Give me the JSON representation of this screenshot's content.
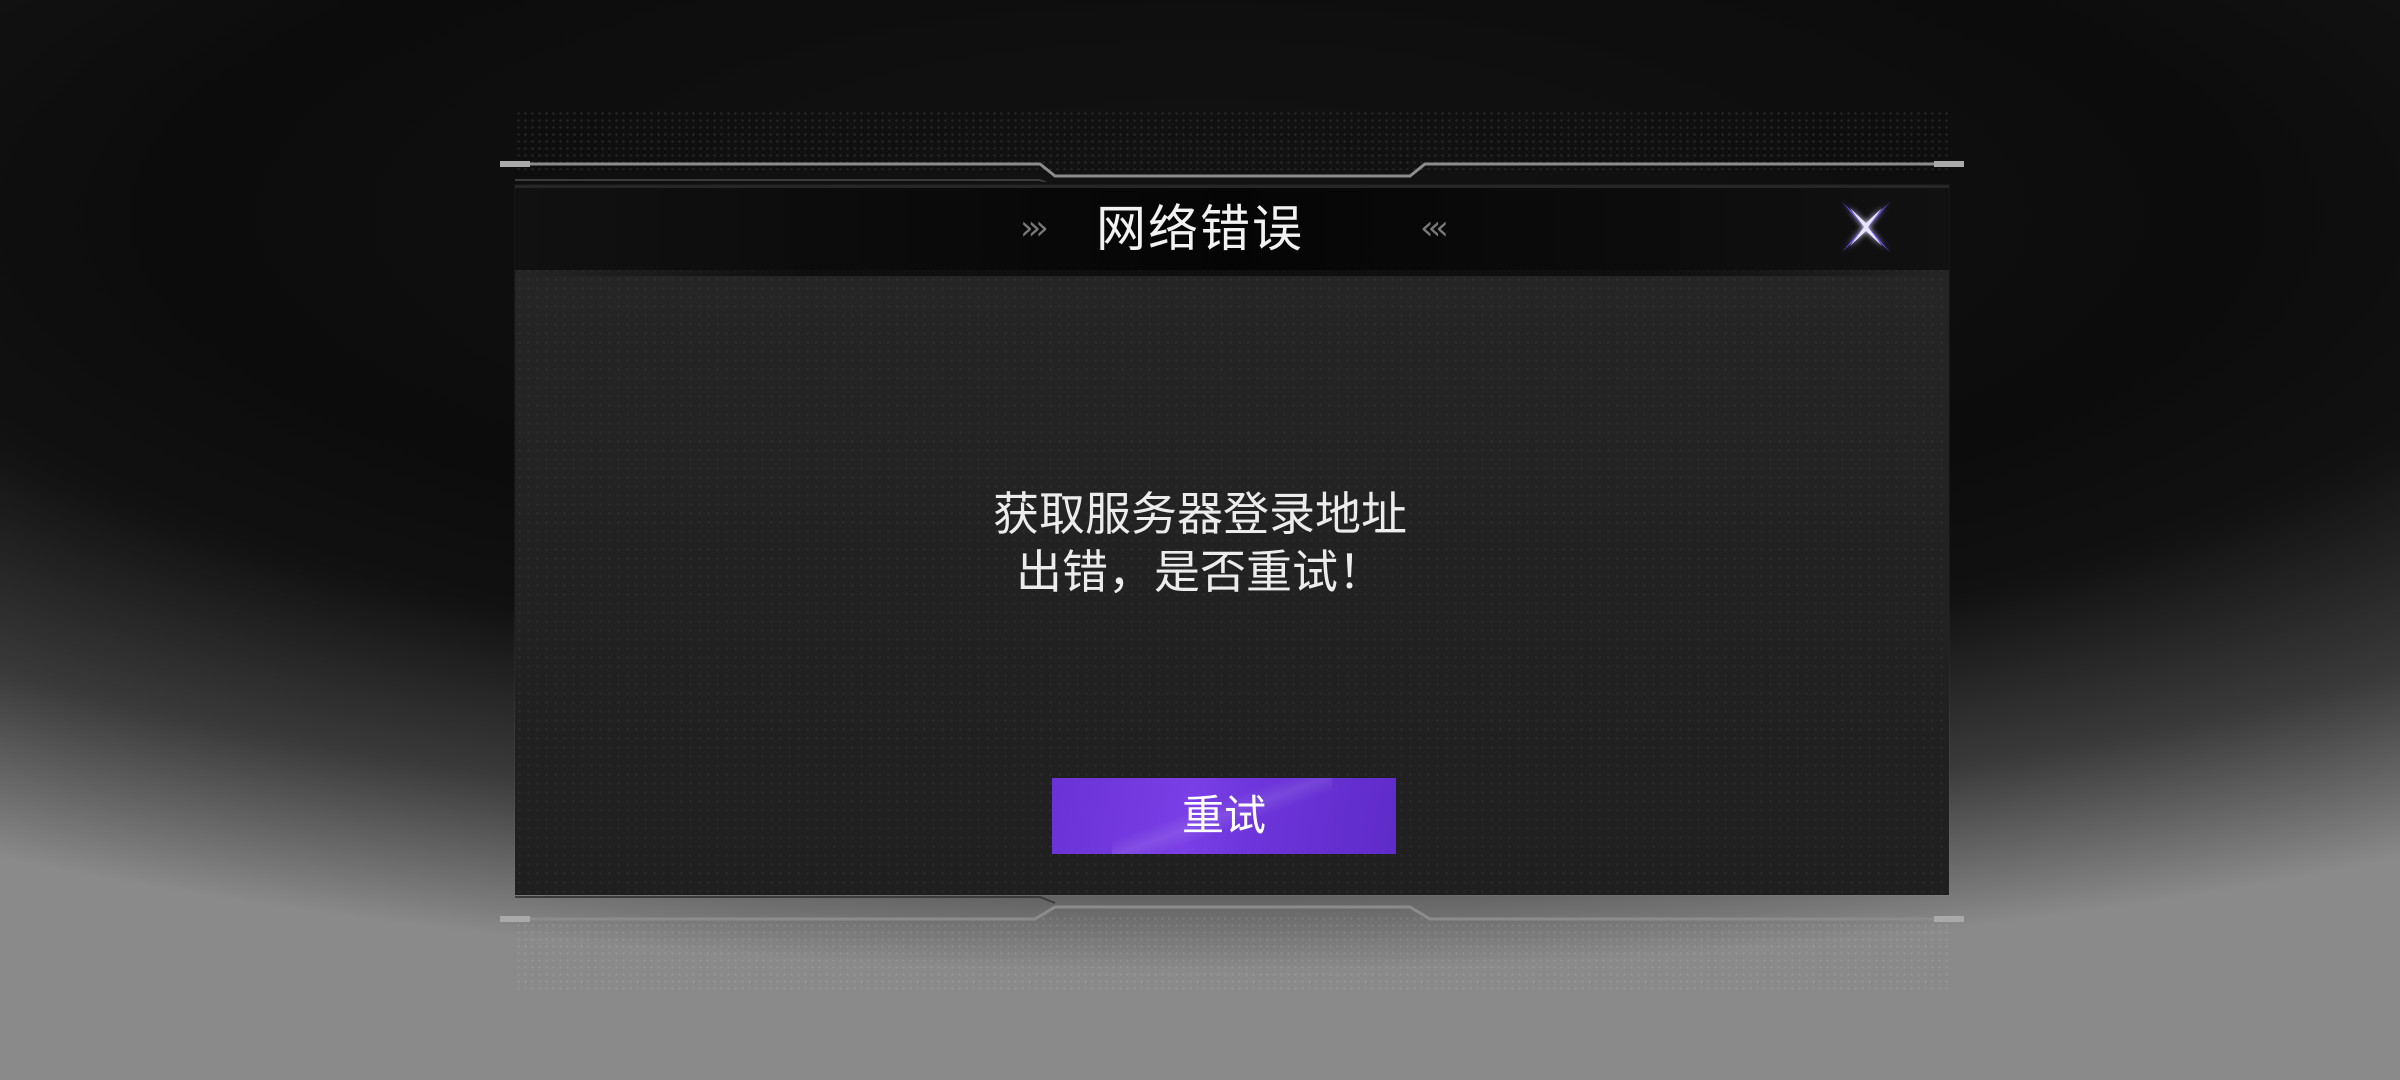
{
  "dialog": {
    "title": "网络错误",
    "title_deco_left": "›››",
    "title_deco_right": "‹‹‹",
    "message_line1": "获取服务器登录地址",
    "message_line2": "出错，是否重试！",
    "retry_label": "重试"
  },
  "icons": {
    "close": "close-x-icon"
  },
  "colors": {
    "accent": "#6e36dc",
    "close_icon": "#7b5cff",
    "panel": "#232323",
    "title_bar": "#080808",
    "text": "#f2f2f2"
  }
}
